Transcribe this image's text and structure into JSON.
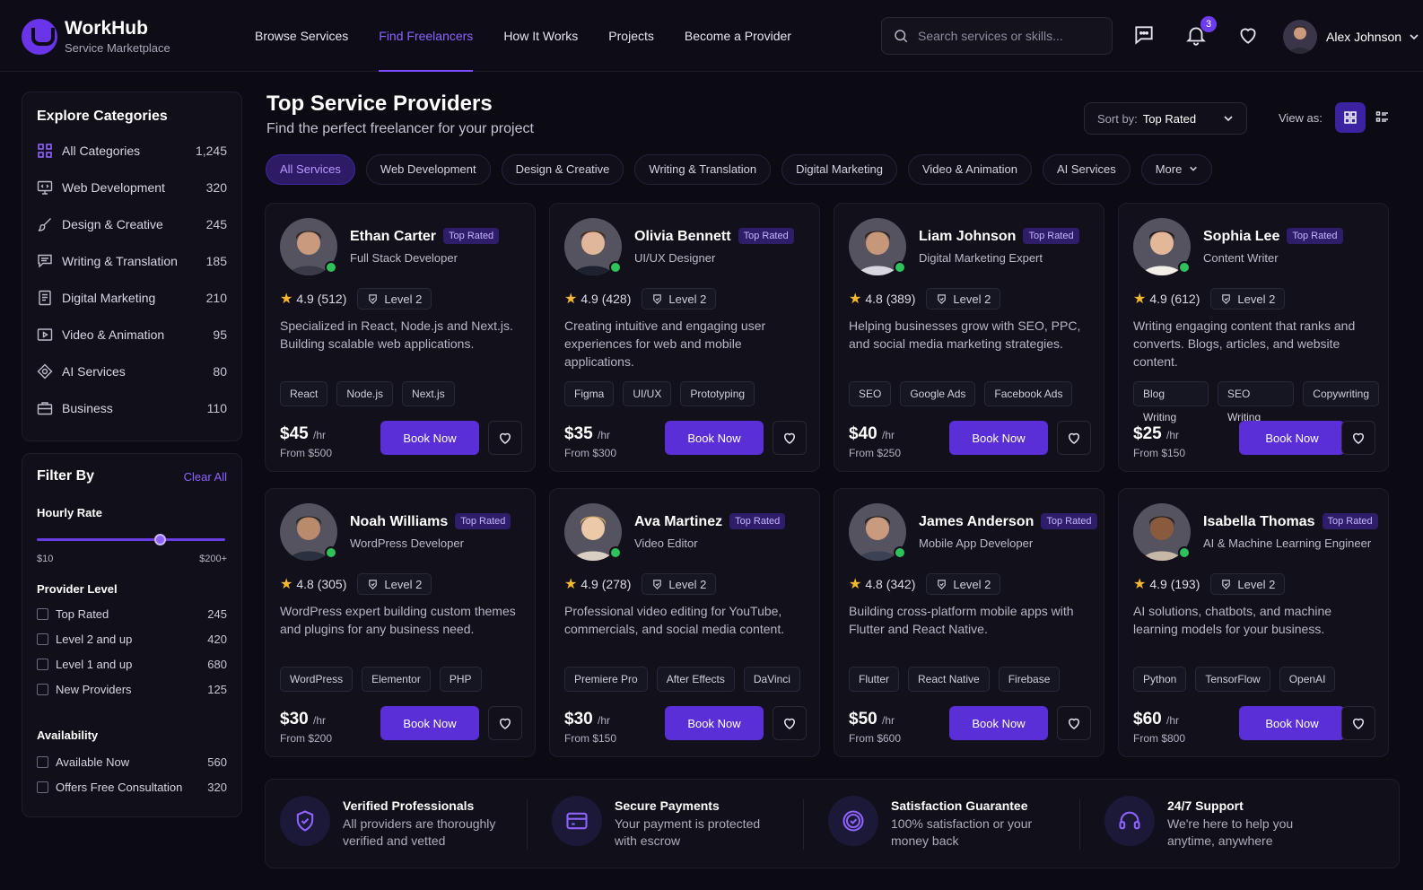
{
  "brand": {
    "title": "WorkHub",
    "subtitle": "Service Marketplace"
  },
  "nav": [
    "Browse Services",
    "Find Freelancers",
    "How It Works",
    "Projects",
    "Become a Provider"
  ],
  "nav_active": "Find Freelancers",
  "search": {
    "placeholder": "Search services or skills..."
  },
  "notifications": {
    "count": "3"
  },
  "user": {
    "name": "Alex Johnson"
  },
  "sidebar": {
    "title": "Explore Categories",
    "categories": [
      {
        "label": "All Categories",
        "count": "1,245",
        "icon": "grid-icon"
      },
      {
        "label": "Web Development",
        "count": "320",
        "icon": "monitor-code-icon"
      },
      {
        "label": "Design & Creative",
        "count": "245",
        "icon": "brush-icon"
      },
      {
        "label": "Writing & Translation",
        "count": "185",
        "icon": "chat-lines-icon"
      },
      {
        "label": "Digital Marketing",
        "count": "210",
        "icon": "document-icon"
      },
      {
        "label": "Video & Animation",
        "count": "95",
        "icon": "video-icon"
      },
      {
        "label": "AI Services",
        "count": "80",
        "icon": "ai-target-icon"
      },
      {
        "label": "Business",
        "count": "110",
        "icon": "briefcase-icon"
      }
    ]
  },
  "filters": {
    "title": "Filter By",
    "clear": "Clear All",
    "hourly_rate": {
      "label": "Hourly Rate",
      "min": "$10",
      "max": "$200+",
      "value_fraction": 0.65
    },
    "provider_level": {
      "label": "Provider Level",
      "options": [
        {
          "label": "Top Rated",
          "count": "245"
        },
        {
          "label": "Level 2 and up",
          "count": "420"
        },
        {
          "label": "Level 1 and up",
          "count": "680"
        },
        {
          "label": "New Providers",
          "count": "125"
        }
      ]
    },
    "availability": {
      "label": "Availability",
      "options": [
        {
          "label": "Available Now",
          "count": "560"
        },
        {
          "label": "Offers Free Consultation",
          "count": "320"
        }
      ]
    }
  },
  "main": {
    "title": "Top Service Providers",
    "subtitle": "Find the perfect freelancer for your project"
  },
  "sort": {
    "label": "Sort by:",
    "value": "Top Rated"
  },
  "view_as": "View as:",
  "chips": [
    "All Services",
    "Web Development",
    "Design & Creative",
    "Writing & Translation",
    "Digital Marketing",
    "Video & Animation",
    "AI Services",
    "More"
  ],
  "badge_label": "Top Rated",
  "book_label": "Book Now",
  "providers": [
    {
      "name": "Ethan Carter",
      "role": "Full Stack Developer",
      "rating": "4.9 (512)",
      "level": "Level 2",
      "desc": "Specialized in React, Node.js and Next.js. Building scalable web applications.",
      "tags": [
        "React",
        "Node.js",
        "Next.js"
      ],
      "price": "$45",
      "unit": "/hr",
      "from": "From $500"
    },
    {
      "name": "Olivia Bennett",
      "role": "UI/UX Designer",
      "rating": "4.9 (428)",
      "level": "Level 2",
      "desc": "Creating intuitive and engaging user experiences for web and mobile applications.",
      "tags": [
        "Figma",
        "UI/UX",
        "Prototyping"
      ],
      "price": "$35",
      "unit": "/hr",
      "from": "From $300"
    },
    {
      "name": "Liam Johnson",
      "role": "Digital Marketing Expert",
      "rating": "4.8 (389)",
      "level": "Level 2",
      "desc": "Helping businesses grow with SEO, PPC, and social media marketing strategies.",
      "tags": [
        "SEO",
        "Google Ads",
        "Facebook Ads"
      ],
      "price": "$40",
      "unit": "/hr",
      "from": "From $250"
    },
    {
      "name": "Sophia Lee",
      "role": "Content Writer",
      "rating": "4.9 (612)",
      "level": "Level 2",
      "desc": "Writing engaging content that ranks and converts. Blogs, articles, and website content.",
      "tags": [
        "Blog Writing",
        "SEO Writing",
        "Copywriting"
      ],
      "price": "$25",
      "unit": "/hr",
      "from": "From $150"
    },
    {
      "name": "Noah Williams",
      "role": "WordPress Developer",
      "rating": "4.8 (305)",
      "level": "Level 2",
      "desc": "WordPress expert building custom themes and plugins for any business need.",
      "tags": [
        "WordPress",
        "Elementor",
        "PHP"
      ],
      "price": "$30",
      "unit": "/hr",
      "from": "From $200"
    },
    {
      "name": "Ava Martinez",
      "role": "Video Editor",
      "rating": "4.9 (278)",
      "level": "Level 2",
      "desc": "Professional video editing for YouTube, commercials, and social media content.",
      "tags": [
        "Premiere Pro",
        "After Effects",
        "DaVinci"
      ],
      "price": "$30",
      "unit": "/hr",
      "from": "From $150"
    },
    {
      "name": "James Anderson",
      "role": "Mobile App Developer",
      "rating": "4.8 (342)",
      "level": "Level 2",
      "desc": "Building cross-platform mobile apps with Flutter and React Native.",
      "tags": [
        "Flutter",
        "React Native",
        "Firebase"
      ],
      "price": "$50",
      "unit": "/hr",
      "from": "From $600"
    },
    {
      "name": "Isabella Thomas",
      "role": "AI & Machine Learning Engineer",
      "rating": "4.9 (193)",
      "level": "Level 2",
      "desc": "AI solutions, chatbots, and machine learning models for your business.",
      "tags": [
        "Python",
        "TensorFlow",
        "OpenAI"
      ],
      "price": "$60",
      "unit": "/hr",
      "from": "From $800"
    }
  ],
  "features": [
    {
      "title": "Verified Professionals",
      "desc": "All providers are thoroughly verified and vetted",
      "icon": "shield-check-icon"
    },
    {
      "title": "Secure Payments",
      "desc": "Your payment is protected with escrow",
      "icon": "card-icon"
    },
    {
      "title": "Satisfaction Guarantee",
      "desc": "100% satisfaction or your money back",
      "icon": "badge-check-icon"
    },
    {
      "title": "24/7 Support",
      "desc": "We're here to help you anytime, anywhere",
      "icon": "headset-icon"
    }
  ],
  "colors": {
    "accent": "#5a2fd8",
    "accent_light": "#8d63ff",
    "background": "#0c0b14",
    "card": "#12111b",
    "online": "#2fc15a",
    "star": "#f5b82e"
  }
}
